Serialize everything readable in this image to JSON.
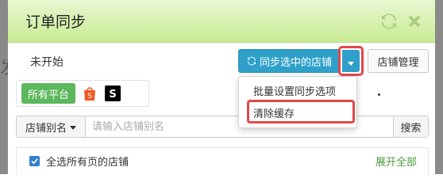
{
  "dialog": {
    "title": "订单同步",
    "icons": {
      "refresh": "refresh-icon",
      "close": "close-icon"
    }
  },
  "status": "未开始",
  "toolbar": {
    "sync_selected_label": "同步选中的店铺",
    "store_manage_label": "店铺管理"
  },
  "dropdown_menu": {
    "items": [
      {
        "label": "批量设置同步选项"
      },
      {
        "label": "清除缓存"
      }
    ]
  },
  "platforms": {
    "all_label": "所有平台",
    "items": [
      {
        "icon": "shopee-icon",
        "color": "#f05a28"
      },
      {
        "icon": "shein-icon",
        "color": "#000000"
      }
    ]
  },
  "search": {
    "field_select": "店铺别名",
    "placeholder": "请输入店铺别名",
    "button_label": "搜索"
  },
  "select_all": {
    "label": "全选所有页的店铺",
    "checked": true,
    "expand_label": "展开全部"
  },
  "colors": {
    "primary": "#2ea0c9",
    "success": "#5cb85c",
    "highlight": "#e0484a",
    "header_green": "#c9ec94",
    "link_green": "#4a9a3a"
  }
}
